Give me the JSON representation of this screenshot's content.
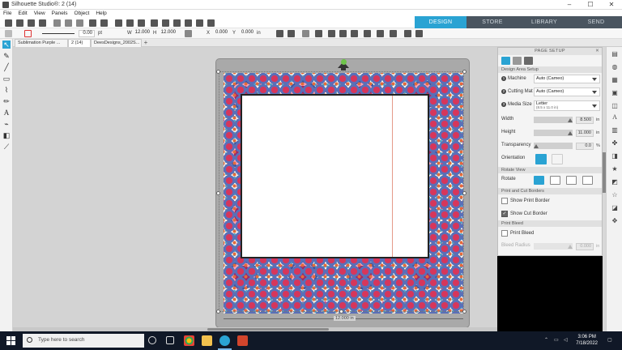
{
  "window": {
    "title": "Silhouette Studio®: 2 (14)",
    "controls": {
      "minimize": "–",
      "maximize": "☐",
      "close": "✕"
    }
  },
  "menu": [
    "File",
    "Edit",
    "View",
    "Panels",
    "Object",
    "Help"
  ],
  "nav_tabs": [
    {
      "label": "DESIGN",
      "active": true
    },
    {
      "label": "STORE",
      "active": false
    },
    {
      "label": "LIBRARY",
      "active": false
    },
    {
      "label": "SEND",
      "active": false
    }
  ],
  "toolbar2": {
    "line_width": "0.00",
    "line_unit": "pt",
    "w_label": "W",
    "w_value": "12.000",
    "h_label": "H",
    "h_value": "12.000",
    "x_label": "X",
    "x_value": "0.000",
    "y_label": "Y",
    "y_value": "0.000",
    "unit": "in"
  },
  "doc_tabs": [
    {
      "label": "Sublimation Purple ...",
      "active": false
    },
    {
      "label": "2 (14)",
      "active": true
    },
    {
      "label": "DeesDesigns_2002S...",
      "active": false
    }
  ],
  "canvas": {
    "width_dimension": "12.000 in"
  },
  "page_setup": {
    "header": "PAGE SETUP",
    "design_area_label": "Design Area Setup",
    "machine_label": "Machine",
    "machine_value": "Auto (Cameo)",
    "cutting_mat_label": "Cutting Mat",
    "cutting_mat_value": "Auto (Cameo)",
    "media_size_label": "Media Size",
    "media_size_value": "Letter",
    "media_size_sub": "(8.5 x 11.0 in)",
    "width_label": "Width",
    "width_value": "8.500",
    "height_label": "Height",
    "height_value": "11.000",
    "transparency_label": "Transparency",
    "transparency_value": "0.0",
    "transparency_unit": "%",
    "unit": "in",
    "orientation_label": "Orientation",
    "rotate_view_label": "Rotate View",
    "rotate_label": "Rotate",
    "print_cut_label": "Print and Cut Borders",
    "show_print_border": "Show Print Border",
    "show_print_border_checked": false,
    "show_cut_border": "Show Cut Border",
    "show_cut_border_checked": true,
    "print_bleed_section": "Print Bleed",
    "print_bleed_label": "Print Bleed",
    "print_bleed_checked": false,
    "bleed_radius_label": "Bleed Radius",
    "bleed_radius_value": "0.000"
  },
  "taskbar": {
    "search_placeholder": "Type here to search",
    "time": "3:06 PM",
    "date": "7/18/2022"
  },
  "colors": {
    "accent": "#2aa3d3",
    "nav_dark": "#4a5560",
    "taskbar": "#101827",
    "workspace": "#d3d3d3"
  }
}
